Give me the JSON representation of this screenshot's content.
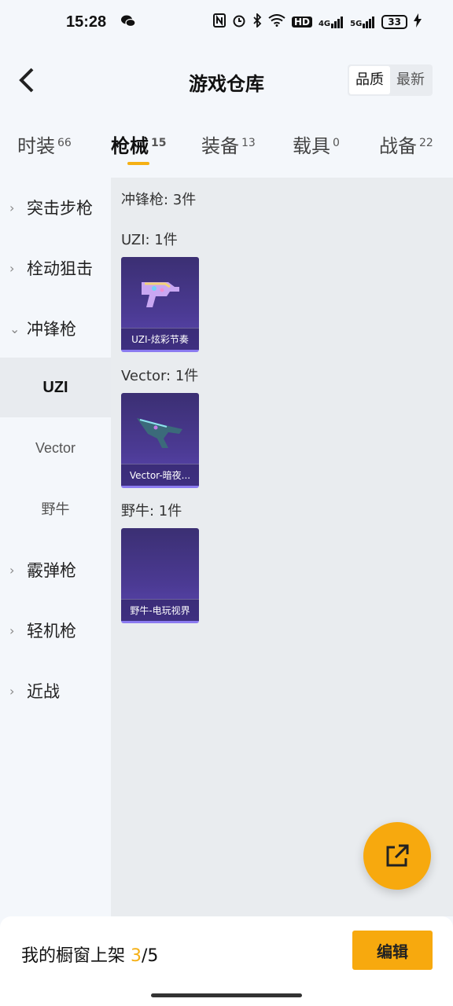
{
  "status_bar": {
    "time": "15:28",
    "icons": [
      "wechat-icon",
      "nfc-icon",
      "alarm-icon",
      "bluetooth-icon",
      "wifi-icon",
      "hd-icon",
      "4g-signal-icon",
      "5g-signal-icon",
      "battery-icon",
      "charging-icon"
    ],
    "network_a": "HD",
    "network_b": "4G",
    "network_c": "5G",
    "battery": "33"
  },
  "header": {
    "title": "游戏仓库",
    "sort_options": [
      "品质",
      "最新"
    ],
    "sort_selected": "品质"
  },
  "tabs": [
    {
      "label": "时装",
      "count": "66"
    },
    {
      "label": "枪械",
      "count": "15"
    },
    {
      "label": "装备",
      "count": "13"
    },
    {
      "label": "载具",
      "count": "0"
    },
    {
      "label": "战备",
      "count": "22"
    }
  ],
  "sidebar": {
    "categories": [
      "突击步枪",
      "栓动狙击",
      "冲锋枪",
      "霰弹枪",
      "轻机枪",
      "近战"
    ],
    "expanded": "冲锋枪",
    "subcategories": [
      "UZI",
      "Vector",
      "野牛"
    ],
    "selected": "UZI"
  },
  "main": {
    "section_title": "冲锋枪: 3件",
    "groups": [
      {
        "label": "UZI: 1件",
        "item": "UZI-炫彩节奏"
      },
      {
        "label": "Vector: 1件",
        "item": "Vector-暗夜..."
      },
      {
        "label": "野牛: 1件",
        "item": "野牛-电玩视界"
      }
    ]
  },
  "bottom": {
    "showcase_prefix": "我的橱窗上架 ",
    "showcase_current": "3",
    "showcase_total": "/5",
    "edit_label": "编辑"
  },
  "colors": {
    "accent": "#f7a90e",
    "card": "#4b3a93"
  }
}
